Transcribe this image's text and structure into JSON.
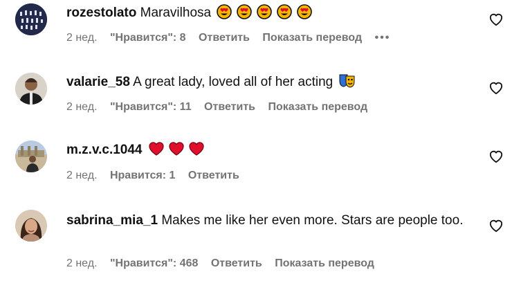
{
  "comments": [
    {
      "username": "rozestolato",
      "text": "Maravilhosa",
      "emoji": "heart-eyes x5",
      "time": "2 нед.",
      "likes": "\"Нравится\": 8",
      "reply": "Ответить",
      "translate": "Показать перевод",
      "more": "•••"
    },
    {
      "username": "valarie_58",
      "text": "A great lady, loved all of her acting",
      "emoji": "performing-arts-masks",
      "time": "2 нед.",
      "likes": "\"Нравится\": 11",
      "reply": "Ответить",
      "translate": "Показать перевод"
    },
    {
      "username": "m.z.v.c.1044",
      "text": "",
      "emoji": "red-hearts x3",
      "time": "2 нед.",
      "likes": "Нравится: 1",
      "reply": "Ответить"
    },
    {
      "username": "sabrina_mia_1",
      "text": "Makes me like her even more. Stars are people too.",
      "time": "2 нед.",
      "likes": "\"Нравится\": 468",
      "reply": "Ответить",
      "translate": "Показать перевод"
    }
  ],
  "colors": {
    "meta": "#737373",
    "heart_emoji": "#e0102d",
    "face_emoji": "#f7b500"
  }
}
